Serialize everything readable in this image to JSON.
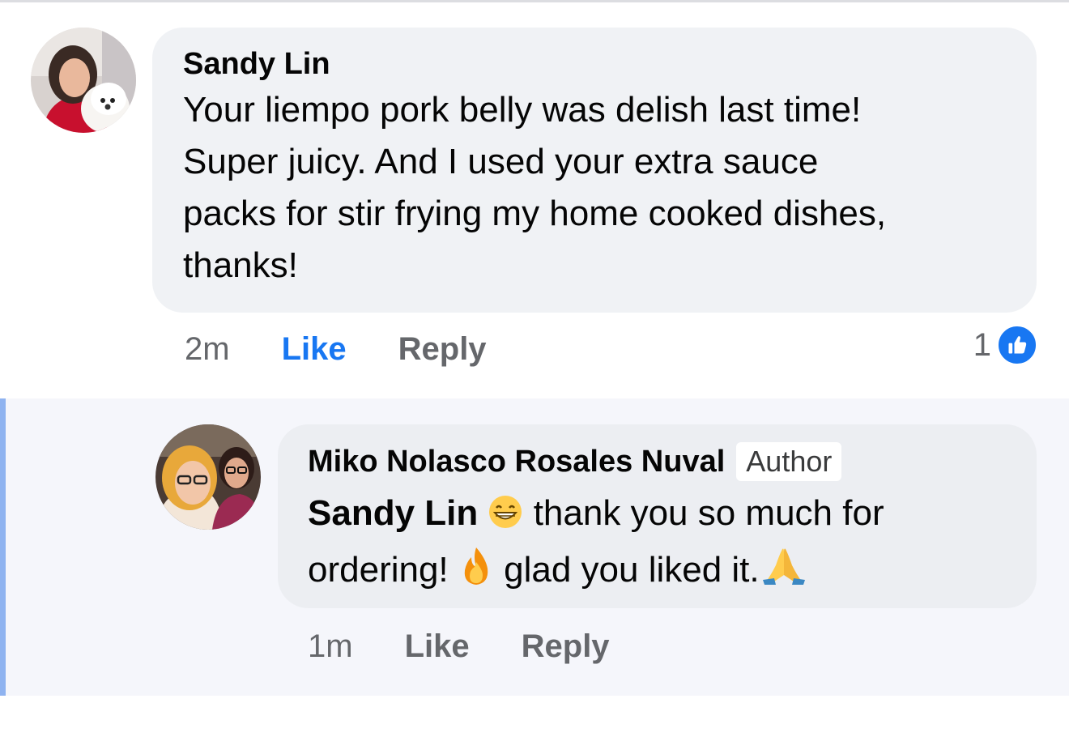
{
  "comments": [
    {
      "author": "Sandy Lin",
      "text_lines": [
        "Your liempo pork belly was delish last time!",
        "Super juicy. And I used your extra sauce",
        "packs for stir frying my home cooked dishes,",
        "thanks!"
      ],
      "time": "2m",
      "like_label": "Like",
      "reply_label": "Reply",
      "reaction_count": "1",
      "avatar_icon": "avatar-woman-with-white-dog"
    }
  ],
  "reply": {
    "author": "Miko Nolasco Rosales Nuval",
    "author_badge": "Author",
    "mention": "Sandy Lin",
    "text_part1": " thank you so much for",
    "text_part2": "ordering! ",
    "text_part3": " glad you liked it.",
    "emojis": [
      "grinning-face-emoji",
      "fire-emoji",
      "praying-hands-emoji"
    ],
    "time": "1m",
    "like_label": "Like",
    "reply_label": "Reply",
    "avatar_icon": "avatar-two-women-selfie"
  },
  "colors": {
    "like_active": "#1877f2",
    "muted_text": "#65676b",
    "bubble": "#f0f2f5",
    "reply_bar": "#8fb3f0"
  }
}
